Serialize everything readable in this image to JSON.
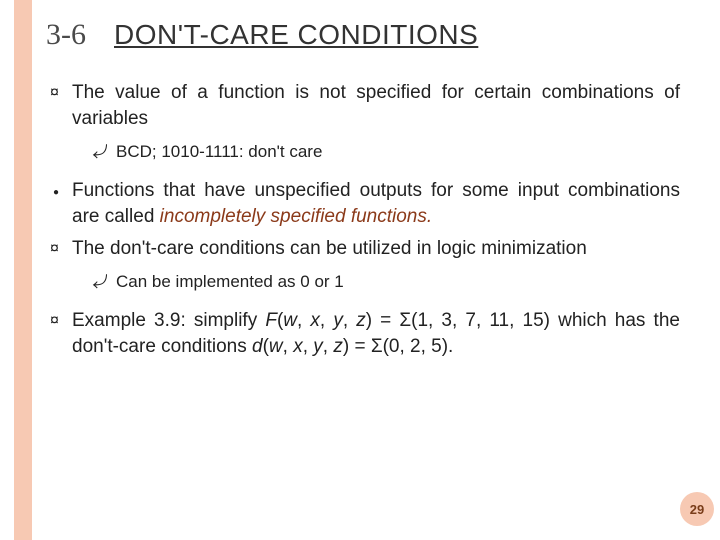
{
  "section_number": "3-6",
  "title": "DON'T-CARE CONDITIONS",
  "bullets": {
    "b1": "The value of a function is not specified for certain combinations of variables",
    "b1_sub1": "BCD; 1010-1111: don't care",
    "b2_pre": "Functions that have unspecified outputs for some input combinations are called ",
    "b2_em": "incompletely specified functions.",
    "b3": "The don't-care conditions can be utilized in logic minimization",
    "b3_sub1": "Can be implemented as 0 or 1",
    "b4_pre": "Example 3.9: simplify ",
    "b4_f": "F",
    "b4_mid1": "(",
    "b4_w": "w",
    "b4_c1": ", ",
    "b4_x": "x",
    "b4_c2": ", ",
    "b4_y": "y",
    "b4_c3": ", ",
    "b4_z": "z",
    "b4_mid2": ") = Σ(1, 3, 7, 11, 15) which has the don't-care conditions ",
    "b4_d": "d",
    "b4_mid3": "(",
    "b4_w2": "w",
    "b4_c4": ", ",
    "b4_x2": "x",
    "b4_c5": ", ",
    "b4_y2": "y",
    "b4_c6": ", ",
    "b4_z2": "z",
    "b4_tail": ") = Σ(0, 2, 5)."
  },
  "page_number": "29"
}
